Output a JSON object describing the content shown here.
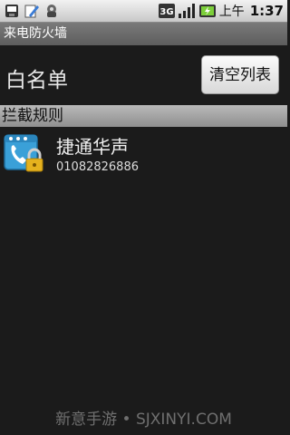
{
  "status_bar": {
    "network_label": "3G",
    "ampm": "上午",
    "time": "1:37",
    "icons": [
      "sd-card-icon",
      "edit-icon",
      "debug-icon",
      "network-3g-icon",
      "signal-icon",
      "battery-charging-icon"
    ]
  },
  "app": {
    "title": "来电防火墙"
  },
  "header": {
    "title": "白名单",
    "clear_button_label": "清空列表"
  },
  "section": {
    "title": "拦截规则"
  },
  "list": {
    "items": [
      {
        "name": "捷通华声",
        "number": "01082826886",
        "icon": "phone-lock-icon"
      }
    ]
  },
  "watermark": "新意手游 • SJXINYI.COM"
}
